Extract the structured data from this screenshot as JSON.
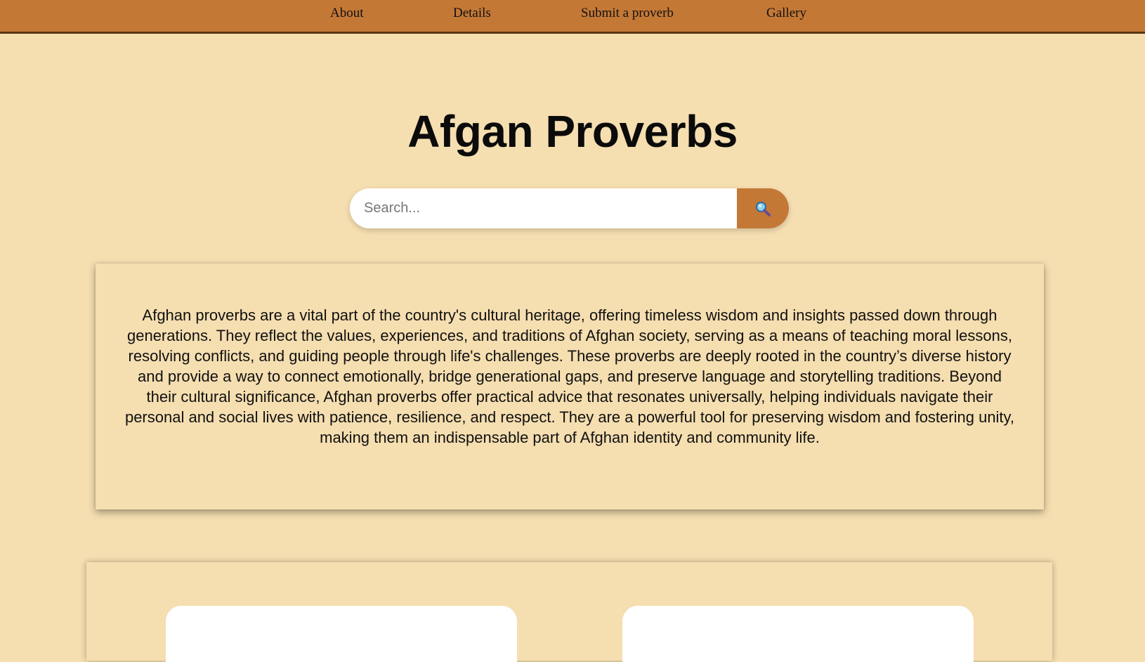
{
  "nav": {
    "items": [
      {
        "label": "About"
      },
      {
        "label": "Details"
      },
      {
        "label": "Submit a proverb"
      },
      {
        "label": "Gallery"
      }
    ]
  },
  "header": {
    "title": "Afgan Proverbs"
  },
  "search": {
    "placeholder": "Search...",
    "value": "",
    "button_icon": "search-icon"
  },
  "about": {
    "text": "Afghan proverbs are a vital part of the country's cultural heritage, offering timeless wisdom and insights passed down through generations. They reflect the values, experiences, and traditions of Afghan society, serving as a means of teaching moral lessons, resolving conflicts, and guiding people through life's challenges. These proverbs are deeply rooted in the country’s diverse history and provide a way to connect emotionally, bridge generational gaps, and preserve language and storytelling traditions. Beyond their cultural significance, Afghan proverbs offer practical advice that resonates universally, helping individuals navigate their personal and social lives with patience, resilience, and respect. They are a powerful tool for preserving wisdom and fostering unity, making them an indispensable part of Afghan identity and community life."
  },
  "colors": {
    "background": "#f5deb0",
    "navbar": "#c47836",
    "navbar_border": "#5a3414",
    "search_button": "#c47836",
    "card": "#ffffff"
  }
}
